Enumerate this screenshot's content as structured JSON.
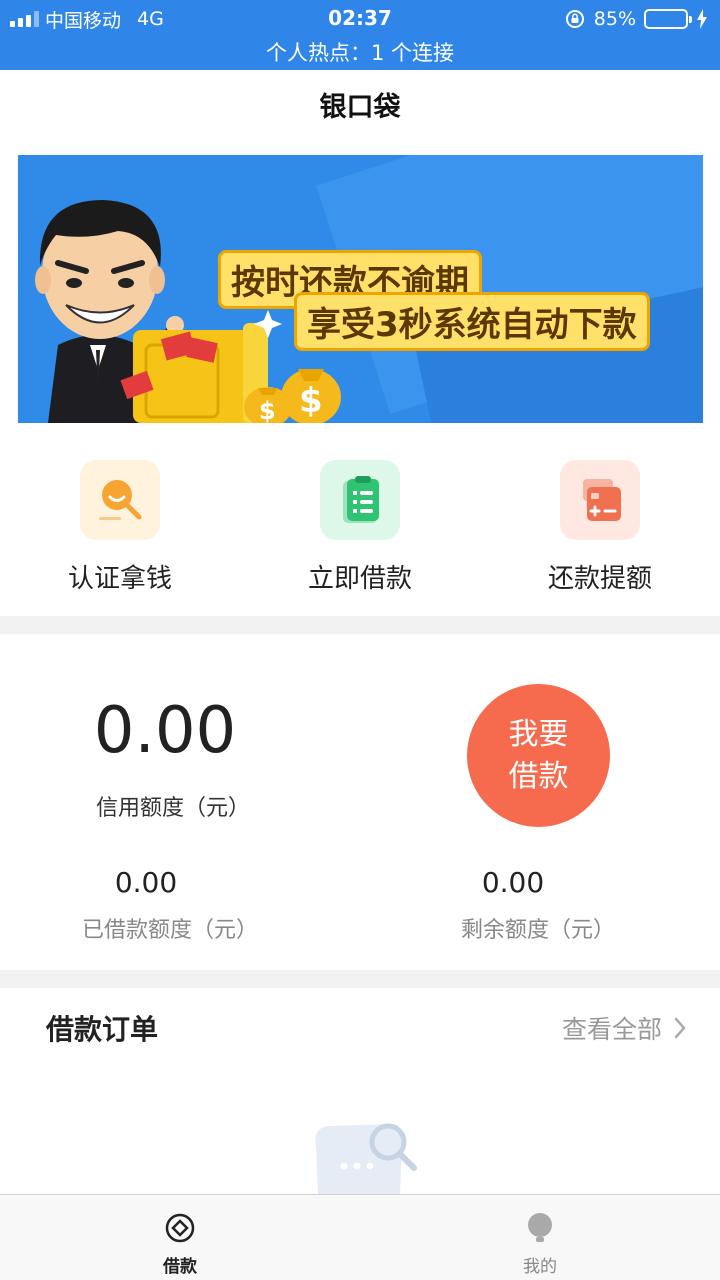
{
  "status_bar": {
    "carrier": "中国移动",
    "network": "4G",
    "time": "02:37",
    "battery": "85%",
    "battery_level": 0.85,
    "hotspot": "个人热点：1 个连接"
  },
  "nav": {
    "title": "银口袋"
  },
  "banner": {
    "line1": "按时还款不逾期",
    "line2": "享受3秒系统自动下款"
  },
  "menu": [
    {
      "label": "认证拿钱",
      "icon": "search-face-icon",
      "color": "#f7a532"
    },
    {
      "label": "立即借款",
      "icon": "clipboard-list-icon",
      "color": "#2fc374"
    },
    {
      "label": "还款提额",
      "icon": "calculator-icon",
      "color": "#f0714f"
    }
  ],
  "credit": {
    "value": "0.00",
    "label": "信用额度（元）",
    "borrow_button_line1": "我要",
    "borrow_button_line2": "借款",
    "borrowed_value": "0.00",
    "borrowed_label": "已借款额度（元）",
    "remaining_value": "0.00",
    "remaining_label": "剩余额度（元）"
  },
  "orders": {
    "title": "借款订单",
    "view_all": "查看全部"
  },
  "tabbar": [
    {
      "label": "借款",
      "active": true
    },
    {
      "label": "我的",
      "active": false
    }
  ],
  "colors": {
    "primary": "#2f86e8",
    "accent": "#f66b4e"
  }
}
